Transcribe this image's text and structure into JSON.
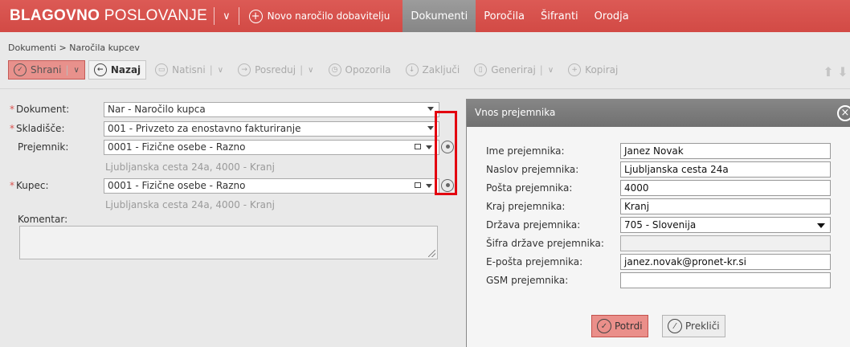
{
  "header": {
    "brand_bold": "BLAGOVNO",
    "brand_light": "POSLOVANJE",
    "new_order": "Novo naročilo dobavitelju",
    "nav": [
      "Dokumenti",
      "Poročila",
      "Šifranti",
      "Orodja"
    ],
    "active_nav": "Dokumenti"
  },
  "breadcrumb": "Dokumenti > Naročila kupcev",
  "toolbar": {
    "save": "Shrani",
    "back": "Nazaj",
    "print": "Natisni",
    "forward": "Posreduj",
    "reminders": "Opozorila",
    "finish": "Zaključi",
    "generate": "Generiraj",
    "copy": "Kopiraj"
  },
  "form": {
    "document_label": "Dokument:",
    "document_value": "Nar - Naročilo kupca",
    "warehouse_label": "Skladišče:",
    "warehouse_value": "001 - Privzeto za enostavno fakturiranje",
    "recipient_label": "Prejemnik:",
    "recipient_value": "0001 - Fizične osebe - Razno",
    "recipient_address": "Ljubljanska cesta 24a, 4000 - Kranj",
    "customer_label": "Kupec:",
    "customer_value": "0001 - Fizične osebe - Razno",
    "customer_address": "Ljubljanska cesta 24a, 4000 - Kranj",
    "comment_label": "Komentar:",
    "required_mark": "*"
  },
  "dialog": {
    "title": "Vnos prejemnika",
    "fields": [
      {
        "label": "Ime prejemnika:",
        "value": "Janez Novak"
      },
      {
        "label": "Naslov prejemnika:",
        "value": "Ljubljanska cesta 24a"
      },
      {
        "label": "Pošta prejemnika:",
        "value": "4000"
      },
      {
        "label": "Kraj prejemnika:",
        "value": "Kranj"
      },
      {
        "label": "Država prejemnika:",
        "value": "705 - Slovenija"
      },
      {
        "label": "Šifra države prejemnika:",
        "value": ""
      },
      {
        "label": "E-pošta prejemnika:",
        "value": "janez.novak@pronet-kr.si"
      },
      {
        "label": "GSM prejemnika:",
        "value": ""
      }
    ],
    "confirm": "Potrdi",
    "cancel": "Prekliči"
  },
  "colors": {
    "accent": "#d9534f",
    "highlight": "#e3000f",
    "dialog_header": "#7b7b7b"
  }
}
